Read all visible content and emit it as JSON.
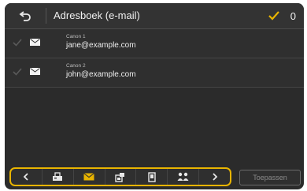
{
  "header": {
    "title": "Adresboek (e-mail)",
    "selected_count": "0",
    "accent_color": "#e8b400"
  },
  "entries": [
    {
      "name": "Canon 1",
      "email": "jane@example.com",
      "icon": "envelope-icon"
    },
    {
      "name": "Canon 2",
      "email": "john@example.com",
      "icon": "envelope-icon"
    }
  ],
  "toolbar": {
    "tabs": [
      {
        "name": "prev-arrow-icon"
      },
      {
        "name": "fax-icon"
      },
      {
        "name": "envelope-icon",
        "active": true
      },
      {
        "name": "file-server-icon"
      },
      {
        "name": "usb-memory-icon"
      },
      {
        "name": "group-icon"
      },
      {
        "name": "next-arrow-icon"
      }
    ],
    "apply_label": "Toepassen"
  }
}
